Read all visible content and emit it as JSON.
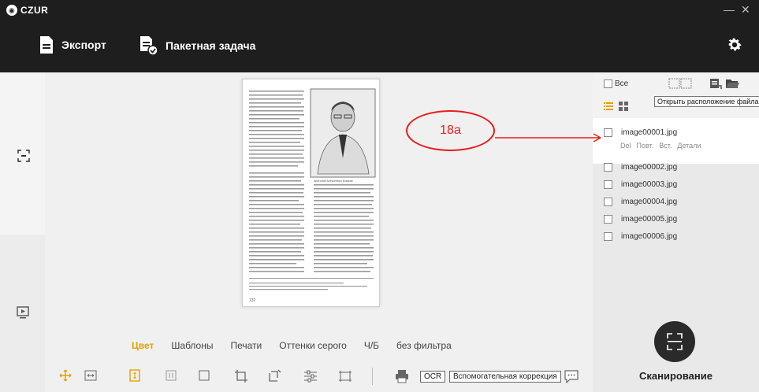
{
  "app": {
    "logo_text": "CZUR",
    "minimize": "—",
    "close": "✕"
  },
  "toolbar": {
    "export_label": "Экспорт",
    "batch_label": "Пакетная задача"
  },
  "filters": {
    "items": [
      "Цвет",
      "Шаблоны",
      "Печати",
      "Оттенки серого",
      "Ч/Б",
      "без фильтра"
    ],
    "active_index": 0
  },
  "tools": {
    "ocr_label": "OCR",
    "assist_label": "Вспомогательная коррекция"
  },
  "right_panel": {
    "select_all_label": "Все",
    "tooltip": "Открыть расположение файла",
    "files": [
      "image00001.jpg",
      "image00002.jpg",
      "image00003.jpg",
      "image00004.jpg",
      "image00005.jpg",
      "image00006.jpg"
    ],
    "selected_file_actions": [
      "Del",
      "Повт.",
      "Вст.",
      "Детали"
    ],
    "scan_label": "Сканирование"
  },
  "annotation": {
    "label": "18a"
  },
  "document": {
    "photo_caption": "Анатолий Алексеевич Козаков",
    "page_number": "132"
  },
  "colors": {
    "accent": "#e7a000",
    "annotation": "#e81c1c",
    "dark": "#1e1e1e"
  }
}
